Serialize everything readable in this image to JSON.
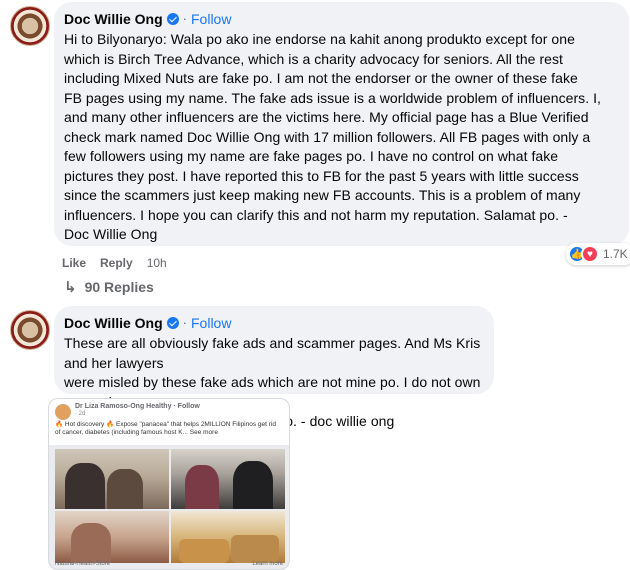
{
  "comments": [
    {
      "author": "Doc Willie Ong",
      "follow_label": "Follow",
      "separator": "·",
      "lines": [
        "Hi to Bilyonaryo: Wala po ako ine endorse na kahit anong produkto except for one",
        "which is Birch Tree Advance, which is a charity advocacy for seniors. All the rest",
        "including Mixed Nuts are fake po. I am not the endorser or the owner of these fake",
        "FB pages using my name. The fake ads issue is a worldwide problem of influencers. I,",
        "and many other influencers are the victims here. My official page has a Blue Verified",
        "check mark named Doc Willie Ong with 17 million followers. All FB pages with only a",
        "few followers using my name are fake pages po. I have no control on what fake",
        "pictures they post. I have reported this to FB for the past 5 years with little success",
        "since the scammers just keep making new FB accounts. This is a problem of many",
        "influencers. I hope you can clarify this and not harm my reputation. Salamat po. -",
        "Doc Willie Ong"
      ],
      "like_label": "Like",
      "reply_label": "Reply",
      "time": "10h",
      "reaction_count": "1.7K",
      "replies_label": "90 Replies"
    },
    {
      "author": "Doc Willie Ong",
      "follow_label": "Follow",
      "separator": "·",
      "lines": [
        "These are all obviously fake ads and scammer pages. And Ms Kris and her lawyers",
        "were misled by these fake ads which are not mine po. I do not own nor endorse",
        "these products. Please be careful po. - doc willie ong"
      ]
    }
  ],
  "embed": {
    "page_name": "Dr Liza Ramoso-Ong Healthy · Follow",
    "sub": "· 2d",
    "text": "🔥 Hot discovery 🔥 Expose \"panacea\" that helps 2MILLION Filipinos get rid of cancer, diabetes (including famous host K... See more",
    "footer": "Natural-Health-Store",
    "more": "Learn more"
  },
  "icons": {
    "reply_arrow": "reply-arrow-icon",
    "like_reaction": "like-reaction-icon",
    "love_reaction": "love-reaction-icon",
    "verified": "verified-badge-icon"
  },
  "colors": {
    "accent": "#1877f2",
    "bubble": "#f0f2f5",
    "muted": "#65676b"
  }
}
